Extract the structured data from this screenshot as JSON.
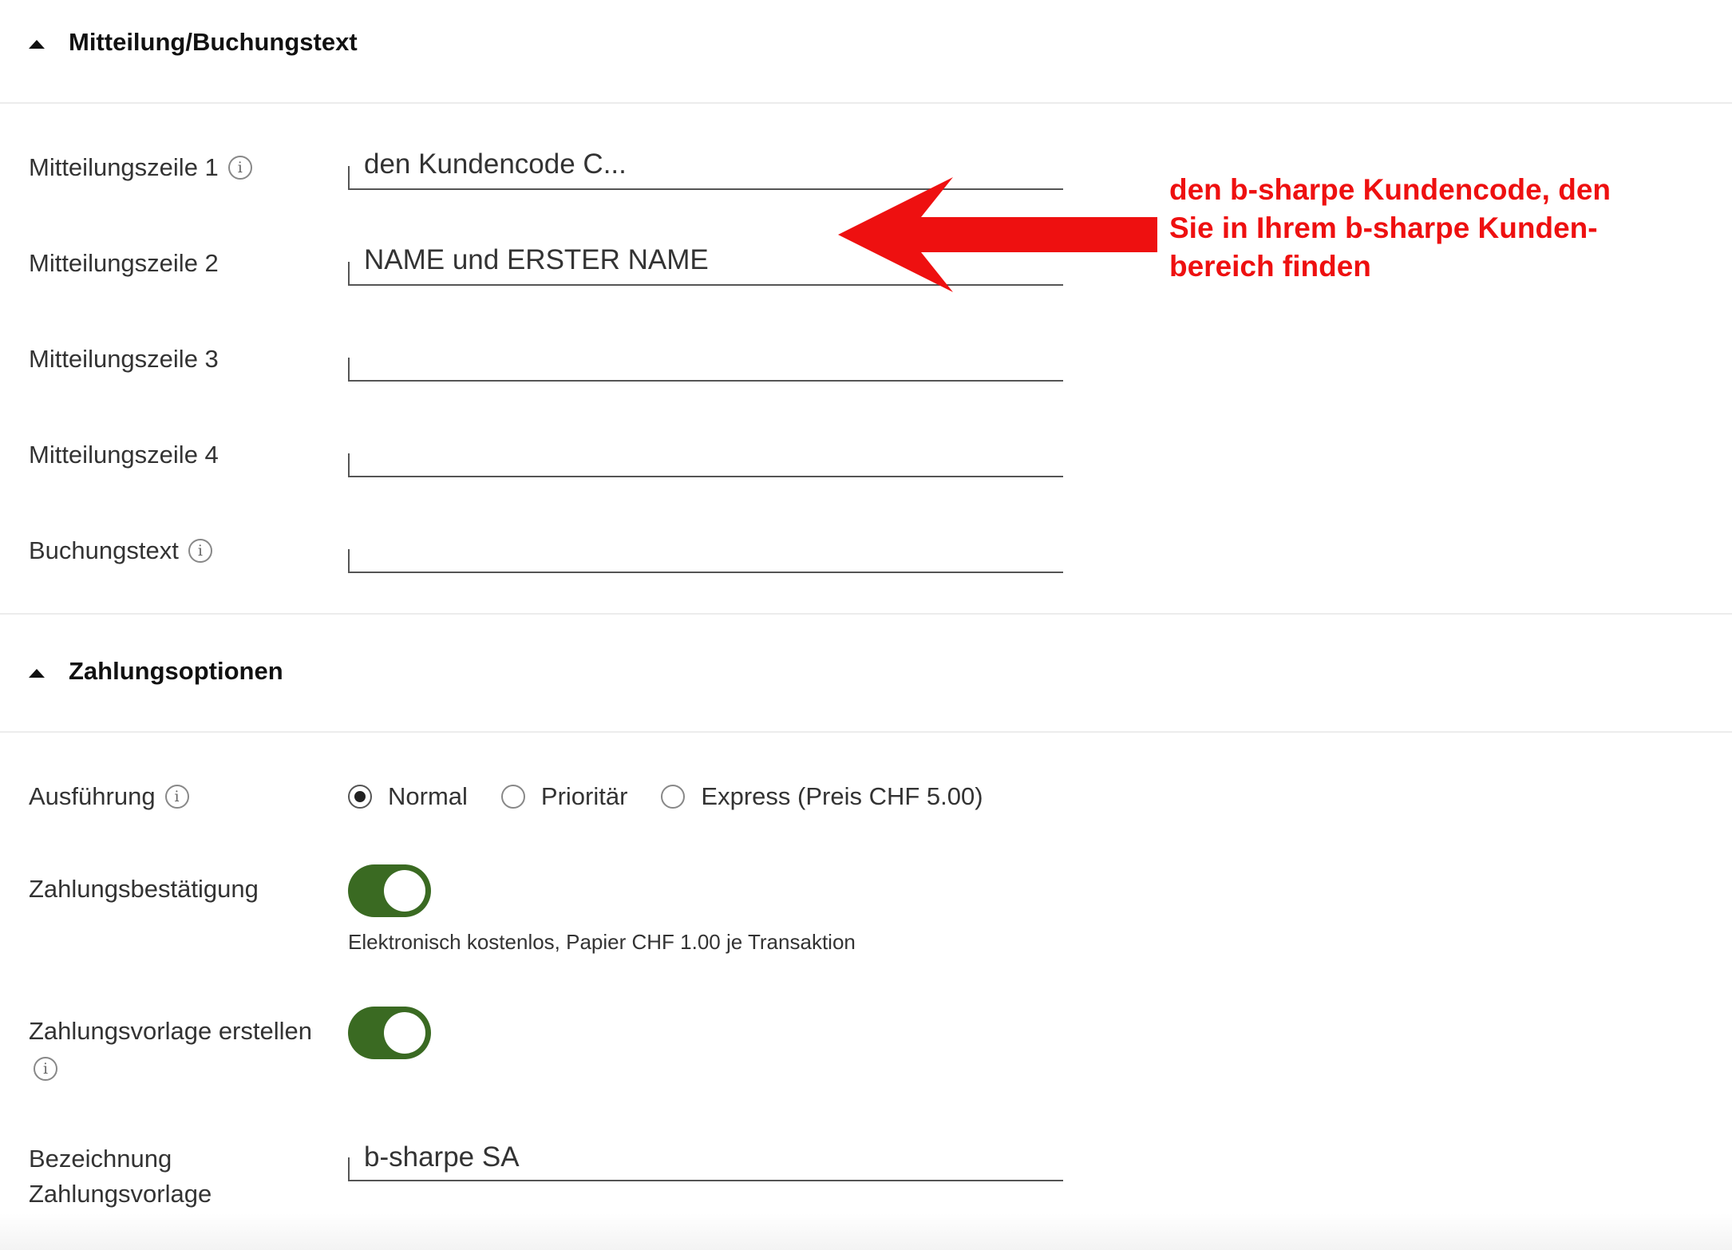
{
  "message_section": {
    "title": "Mitteilung/Buchungstext",
    "rows": [
      {
        "label": "Mitteilungszeile 1",
        "value": "den Kundencode C..."
      },
      {
        "label": "Mitteilungszeile 2",
        "value": "NAME und ERSTER NAME"
      },
      {
        "label": "Mitteilungszeile 3",
        "value": ""
      },
      {
        "label": "Mitteilungszeile 4",
        "value": ""
      },
      {
        "label": "Buchungstext",
        "value": ""
      }
    ]
  },
  "payment_section": {
    "title": "Zahlungsoptionen",
    "execution": {
      "label": "Ausführung",
      "options": [
        "Normal",
        "Prioritär",
        "Express (Preis CHF 5.00)"
      ],
      "selected": "Normal"
    },
    "confirmation": {
      "label": "Zahlungsbestätigung",
      "on": true,
      "hint": "Elektronisch kostenlos, Papier CHF 1.00 je Transaktion"
    },
    "template": {
      "label": "Zahlungsvorlage erstellen",
      "on": true
    },
    "template_name": {
      "label_line1": "Bezeichnung",
      "label_line2": "Zahlungsvorlage",
      "value": "b-sharpe SA"
    }
  },
  "annotation": {
    "lines": [
      "den b-sharpe Kundencode, den",
      "Sie in Ihrem b-sharpe Kunden-",
      "bereich finden"
    ]
  },
  "icons": {
    "info": "i"
  },
  "colors": {
    "toggle_on": "#3a6a22",
    "annotation": "#ee1010"
  }
}
